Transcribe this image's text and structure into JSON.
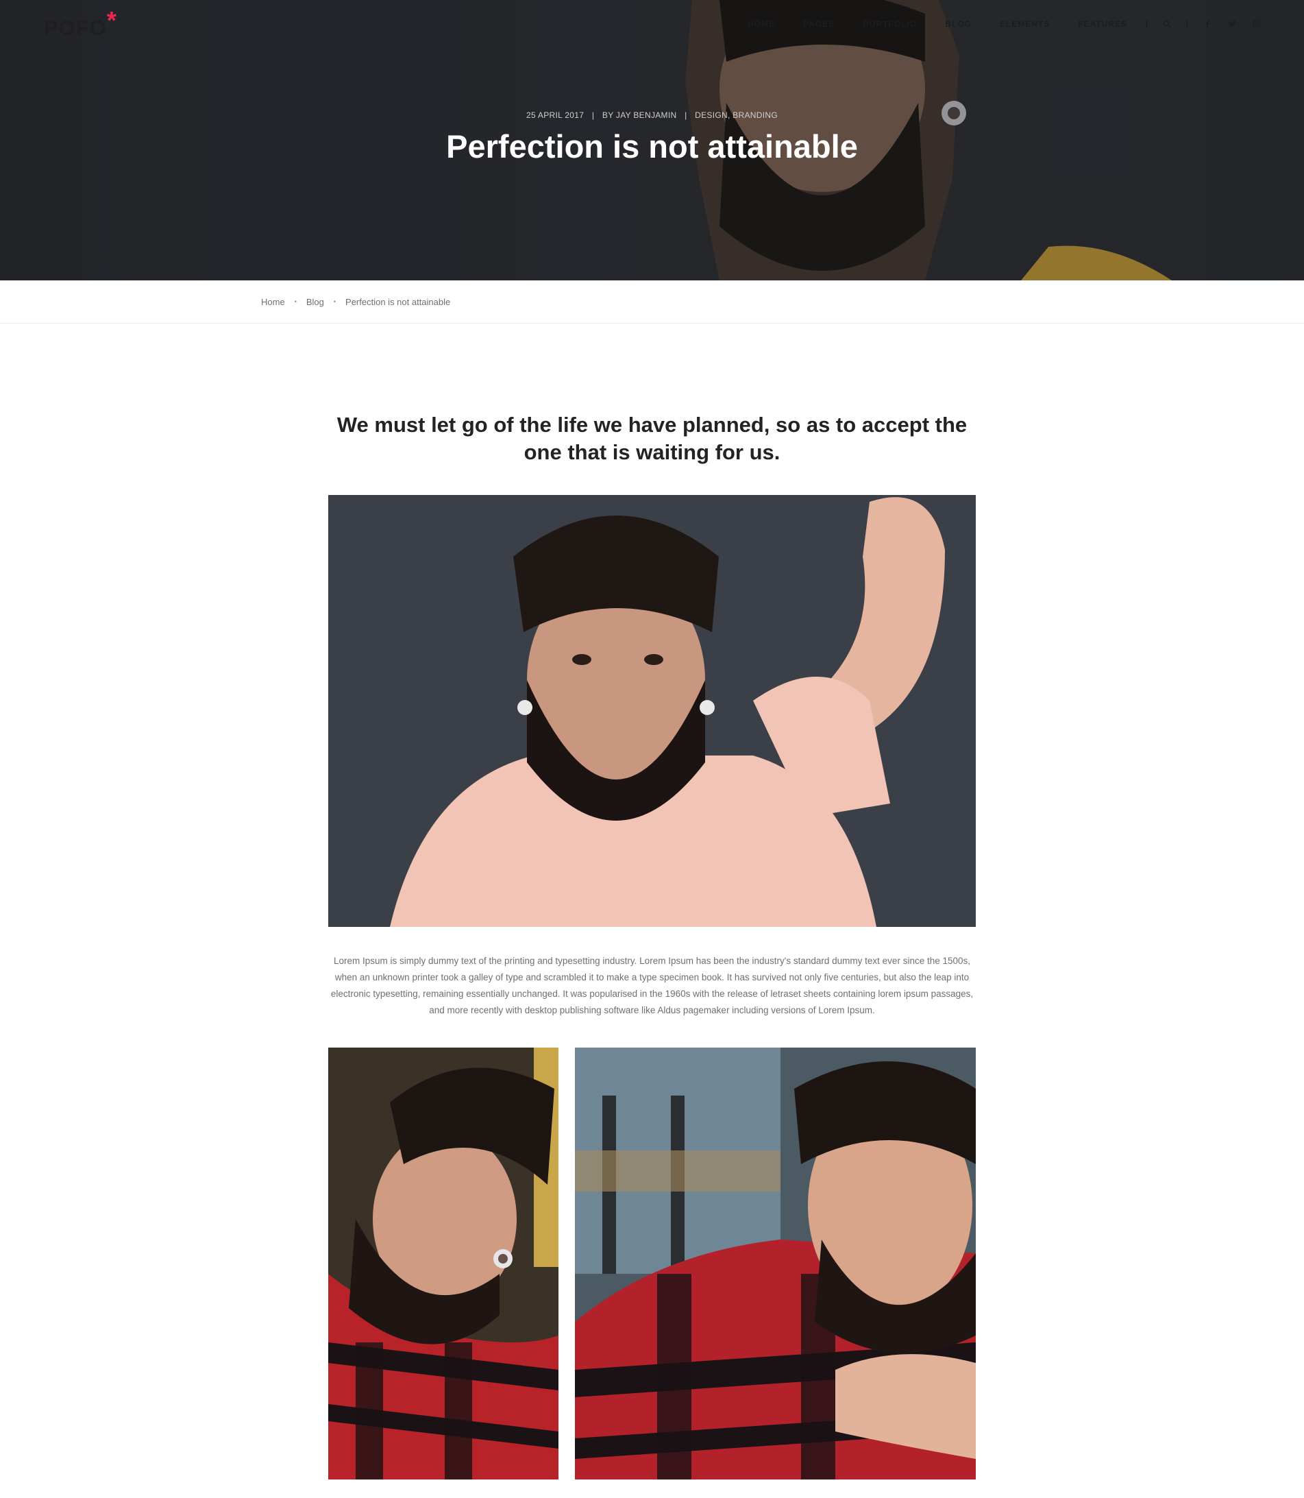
{
  "brand": {
    "name": "POFO",
    "mark": "*",
    "accent": "#f0264f"
  },
  "nav": {
    "items": [
      "HOME",
      "PAGES",
      "PORTFOLIO",
      "BLOG",
      "ELEMENTS",
      "FEATURES"
    ],
    "icons": [
      "search-icon",
      "facebook-icon",
      "twitter-icon",
      "instagram-icon"
    ]
  },
  "hero": {
    "date": "25 APRIL 2017",
    "author": "BY JAY BENJAMIN",
    "categories": "DESIGN, BRANDING",
    "separator": "|",
    "title": "Perfection is not attainable"
  },
  "breadcrumb": {
    "items": [
      "Home",
      "Blog",
      "Perfection is not attainable"
    ],
    "separator": "•"
  },
  "article": {
    "quote": "We must let go of the life we have planned, so as to accept the one that is waiting for us.",
    "body": "Lorem Ipsum is simply dummy text of the printing and typesetting industry. Lorem Ipsum has been the industry's standard dummy text ever since the 1500s, when an unknown printer took a galley of type and scrambled it to make a type specimen book. It has survived not only five centuries, but also the leap into electronic typesetting, remaining essentially unchanged. It was popularised in the 1960s with the release of letraset sheets containing lorem ipsum passages, and more recently with desktop publishing software like Aldus pagemaker including versions of Lorem Ipsum."
  },
  "colors": {
    "hero_bg": "#2d3035",
    "text_dark": "#232323",
    "text_muted": "#6f6f6f"
  }
}
